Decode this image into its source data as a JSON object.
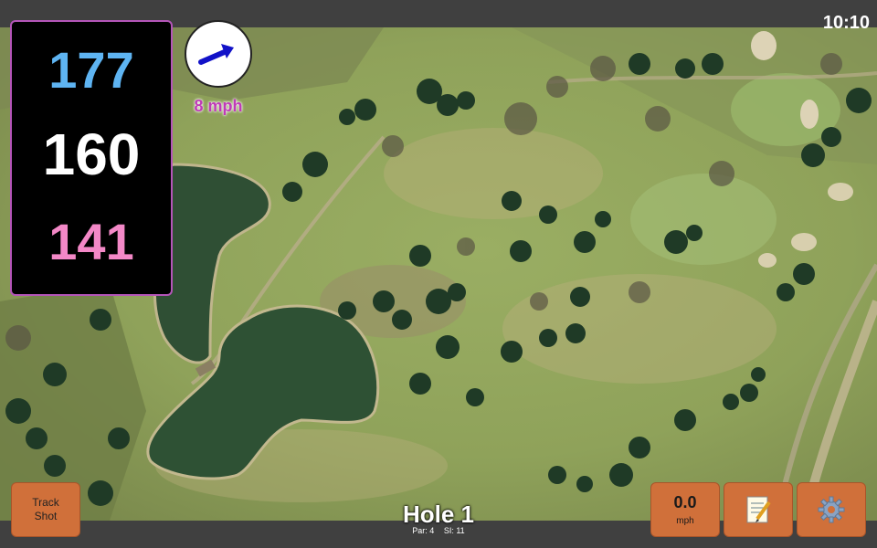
{
  "status": {
    "time": "10:10"
  },
  "distances": {
    "back": "177",
    "center": "160",
    "front": "141"
  },
  "wind": {
    "speed_label": "8 mph",
    "direction_icon": "wind-arrow-icon"
  },
  "hole": {
    "title": "Hole 1",
    "par_label": "Par: 4",
    "si_label": "SI: 11"
  },
  "buttons": {
    "track_shot_line1": "Track",
    "track_shot_line2": "Shot",
    "speed_value": "0.0",
    "speed_unit": "mph",
    "notes_icon": "memo-icon",
    "settings_icon": "gear-icon"
  },
  "colors": {
    "back_distance": "#5eb4f2",
    "center_distance": "#ffffff",
    "front_distance": "#f388c7",
    "panel_border": "#b455b8",
    "button_bg": "#d0703a",
    "wind_label": "#c03ab8"
  }
}
